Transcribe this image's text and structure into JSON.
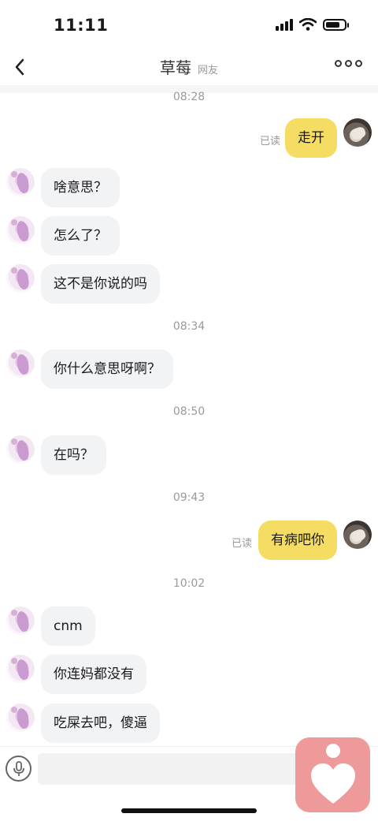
{
  "status_bar": {
    "time": "11:11"
  },
  "header": {
    "title": "草莓",
    "subtitle": "网友"
  },
  "messages": [
    {
      "type": "time",
      "text": "08:28"
    },
    {
      "type": "out",
      "text": "走开",
      "read": "已读"
    },
    {
      "type": "in",
      "text": "啥意思？"
    },
    {
      "type": "in",
      "text": "怎么了？"
    },
    {
      "type": "in",
      "text": "这不是你说的吗"
    },
    {
      "type": "time",
      "text": "08:34"
    },
    {
      "type": "in",
      "text": "你什么意思呀啊？"
    },
    {
      "type": "time",
      "text": "08:50"
    },
    {
      "type": "in",
      "text": "在吗？"
    },
    {
      "type": "time",
      "text": "09:43"
    },
    {
      "type": "out",
      "text": "有病吧你",
      "read": "已读"
    },
    {
      "type": "time",
      "text": "10:02"
    },
    {
      "type": "in",
      "text": "cnm"
    },
    {
      "type": "in",
      "text": "你连妈都没有"
    },
    {
      "type": "in",
      "text": "吃屎去吧，傻逼"
    }
  ],
  "input": {
    "value": "",
    "placeholder": ""
  },
  "colors": {
    "out_bubble": "#f5dc62",
    "in_bubble": "#f2f3f5",
    "fab": "#ee9a9b"
  }
}
